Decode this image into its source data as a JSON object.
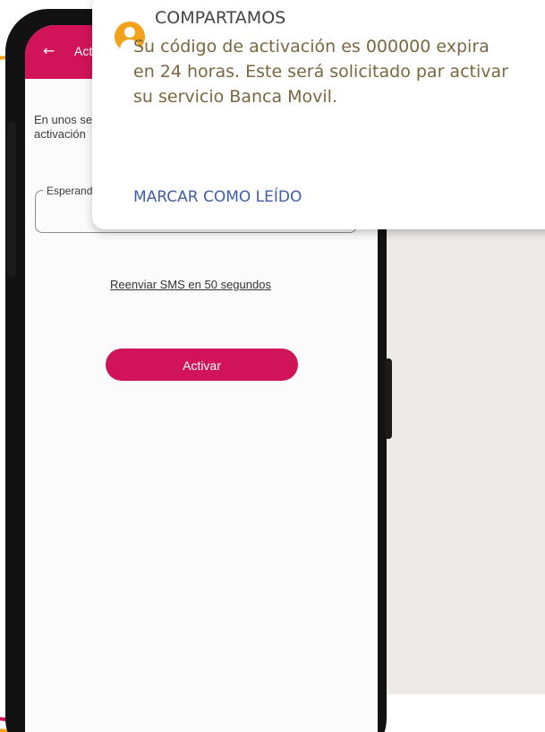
{
  "appbar": {
    "title": "Activar Banca Movil",
    "back_icon": "arrow-left-icon"
  },
  "screen": {
    "intro_text": "En unos segundos recibirás un SMS con tu código de activación",
    "code_field_label": "Esperando código",
    "code_field_value": "",
    "resend_link": "Reenviar SMS en 50 segundos",
    "activate_button": "Activar"
  },
  "notification": {
    "app_name": "COMPARTAMOS",
    "avatar_icon": "person-icon",
    "body_lines": [
      "Su código de activación es 000000 expira",
      "en 24 horas. Este será solicitado par activar",
      "su servicio Banca Movil."
    ],
    "action_label": "MARCAR COMO LEÍDO"
  },
  "colors": {
    "brand_magenta": "#d1135a",
    "brand_orange": "#f4a21c",
    "notif_body_text": "#7a6740",
    "notif_action_text": "#3e5ea9"
  }
}
